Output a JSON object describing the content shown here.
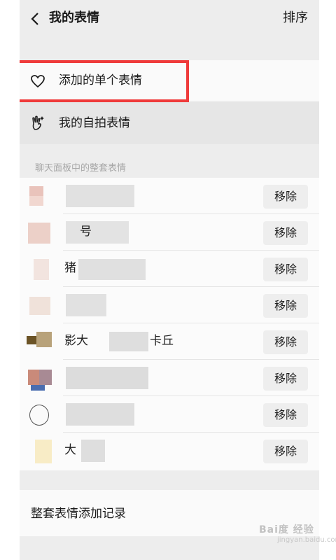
{
  "header": {
    "title": "我的表情",
    "sort_label": "排序"
  },
  "menu": [
    {
      "label": "添加的单个表情",
      "icon": "heart-outline-icon"
    },
    {
      "label": "我的自拍表情",
      "icon": "selfie-hand-icon"
    }
  ],
  "section": {
    "label": "聊天面板中的整套表情"
  },
  "packs": [
    {
      "name": "",
      "remove_label": "移除"
    },
    {
      "name": "号",
      "remove_label": "移除"
    },
    {
      "name": "猪",
      "remove_label": "移除"
    },
    {
      "name": "",
      "remove_label": "移除"
    },
    {
      "name": "影大",
      "suffix": "卡丘",
      "remove_label": "移除"
    },
    {
      "name": "",
      "remove_label": "移除"
    },
    {
      "name": "",
      "remove_label": "移除"
    },
    {
      "name": "大",
      "remove_label": "移除"
    }
  ],
  "footer": {
    "label": "整套表情添加记录"
  },
  "watermark": {
    "text": "Bai度 经验",
    "sub": "jingyan.baidu.com"
  },
  "colors": {
    "highlight": "#ef3b3b",
    "background": "#ededed"
  }
}
